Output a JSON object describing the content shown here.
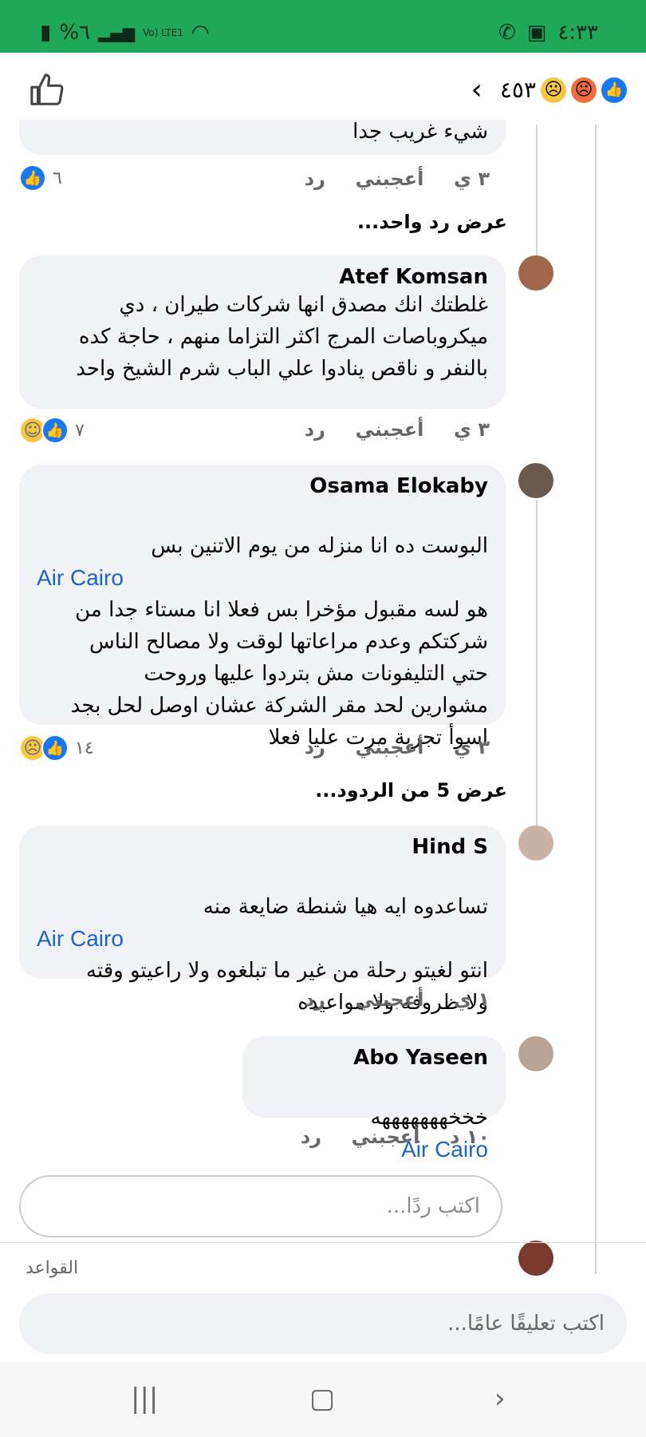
{
  "status_bar": {
    "battery": "%٦",
    "network": "Vo) LTE1",
    "time": "٤:٣٣"
  },
  "header": {
    "reaction_count": "٤٥٣"
  },
  "comments": [
    {
      "partial_text": "شيء غريب جدا",
      "time": "٣ ي",
      "like_label": "أعجبني",
      "reply_label": "رد",
      "reaction_count": "٦"
    },
    {
      "name": "Atef Komsan",
      "text": "غلطتك انك مصدق انها شركات طيران ، دي\nميكروباصات المرج اكثر التزاما منهم ، حاجة كده\nبالنفر و ناقص ينادوا علي الباب شرم الشيخ واحد",
      "time": "٣ ي",
      "like_label": "أعجبني",
      "reply_label": "رد",
      "reaction_count": "٧"
    },
    {
      "name": "Osama Elokaby",
      "tag": "Air Cairo",
      "text_first": "البوست ده انا منزله من يوم الاتنين بس",
      "text": "هو لسه مقبول مؤخرا بس فعلا انا مستاء جدا من\nشركتكم وعدم مراعاتها لوقت ولا مصالح الناس\nحتي التليفونات مش بتردوا عليها وروحت\nمشوارين لحد مقر الشركة عشان اوصل لحل بجد\nاسوأ تجربة مرت عليا فعلا",
      "time": "٣ ي",
      "like_label": "أعجبني",
      "reply_label": "رد",
      "reaction_count": "١٤"
    },
    {
      "name": "Hind S",
      "tag": "Air Cairo",
      "text_first": "تساعدوه ايه هيا شنطة ضايعة منه",
      "text": "انتو لغيتو رحلة من غير ما تبلغوه ولا راعيتو وقته\nولا ظروفه ولا مواعيده",
      "time": "١ ي",
      "like_label": "أعجبني",
      "reply_label": "رد"
    },
    {
      "name": "Abo Yaseen",
      "tag": "Air Cairo",
      "text_first": "خخخهههههههه",
      "time": "١٠ د",
      "like_label": "أعجبني",
      "reply_label": "رد"
    }
  ],
  "view_one_reply": "عرض رد واحد...",
  "view_five_replies": "عرض 5 من الردود...",
  "reply_placeholder": "اكتب ردًا...",
  "rules_label": "القواعد",
  "comment_placeholder": "اكتب تعليقًا عامًا...",
  "colors": {
    "status_bar": "#1fa85a",
    "bubble": "#f0f2f5",
    "link": "#1b64c4",
    "like_blue": "#1877f2"
  }
}
